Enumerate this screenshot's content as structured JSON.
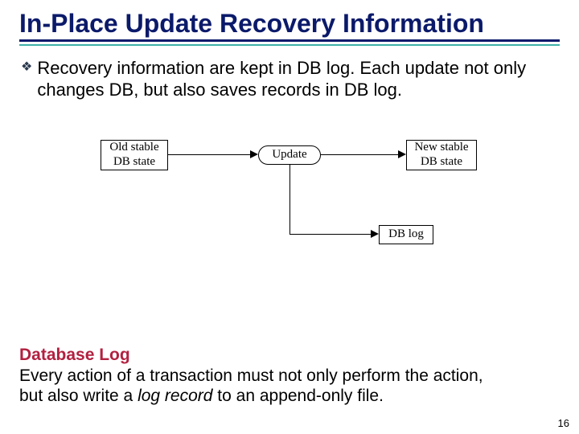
{
  "title": "In-Place Update Recovery Information",
  "bullet": "Recovery information are kept in DB log. Each update not only changes DB, but also saves records in DB log.",
  "diagram": {
    "old": "Old stable DB state",
    "update": "Update",
    "new": "New stable DB state",
    "log": "DB log"
  },
  "footer": {
    "heading": "Database Log",
    "line_a": "Every action of a transaction must not only perform the action,",
    "line_b_prefix": "but also write a ",
    "line_b_italic": "log record",
    "line_b_suffix": " to an append-only file."
  },
  "page_number": "16"
}
